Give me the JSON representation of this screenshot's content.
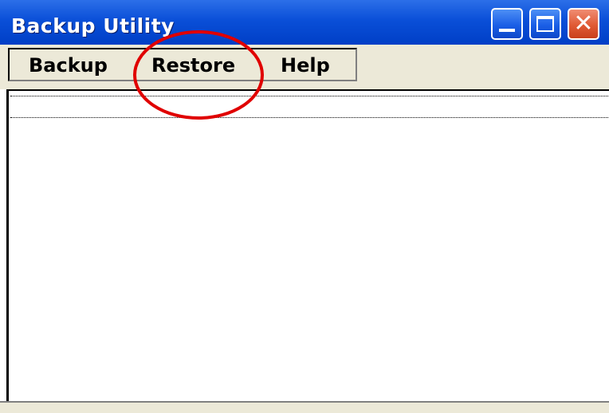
{
  "window": {
    "title": "Backup Utility"
  },
  "titlebar_buttons": {
    "minimize_icon": "minimize-icon",
    "maximize_icon": "maximize-icon",
    "close_icon": "close-icon",
    "close_glyph": "✕"
  },
  "menu": {
    "items": [
      {
        "label": "Backup"
      },
      {
        "label": "Restore"
      },
      {
        "label": "Help"
      }
    ]
  },
  "colors": {
    "titlebar": "#0a4fd8",
    "close_button": "#e05a35",
    "annotation_ring": "#e00000",
    "chrome": "#ece9d8"
  }
}
